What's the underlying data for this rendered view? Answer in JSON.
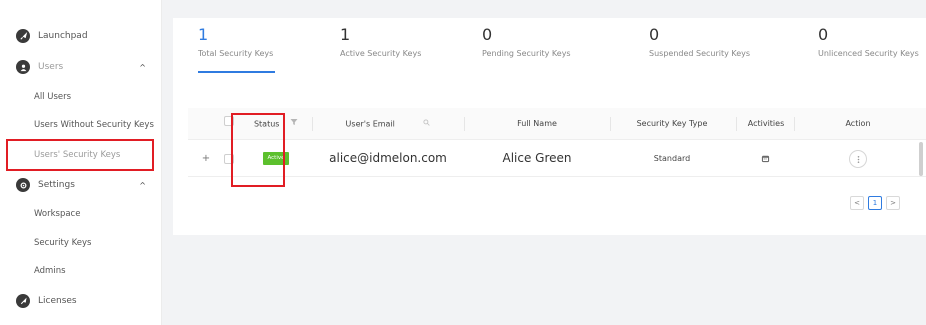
{
  "sidebar": {
    "launchpad": "Launchpad",
    "users": {
      "label": "Users",
      "chevron": "^",
      "items": [
        "All Users",
        "Users Without Security Keys",
        "Users' Security Keys"
      ]
    },
    "settings": {
      "label": "Settings",
      "chevron": "^",
      "items": [
        "Workspace",
        "Security Keys",
        "Admins"
      ]
    },
    "licenses": "Licenses"
  },
  "stats": [
    {
      "value": "1",
      "label": "Total Security Keys"
    },
    {
      "value": "1",
      "label": "Active Security Keys"
    },
    {
      "value": "0",
      "label": "Pending Security Keys"
    },
    {
      "value": "0",
      "label": "Suspended Security Keys"
    },
    {
      "value": "0",
      "label": "Unlicenced Security Keys"
    }
  ],
  "table": {
    "headers": {
      "status": "Status",
      "email": "User's Email",
      "fullname": "Full Name",
      "keytype": "Security Key Type",
      "activities": "Activities",
      "action": "Action"
    },
    "rows": [
      {
        "expand": "+",
        "status": "Active",
        "email": "alice@idmelon.com",
        "fullname": "Alice Green",
        "keytype": "Standard"
      }
    ]
  },
  "pagination": {
    "prev": "<",
    "current": "1",
    "next": ">"
  },
  "colors": {
    "accent": "#2f7be0",
    "highlight": "#e11d24",
    "active_badge": "#5cc02d"
  },
  "icons": [
    "rocket-icon",
    "user-icon",
    "gear-icon",
    "license-icon",
    "filter-icon",
    "search-icon",
    "calendar-icon",
    "more-vertical-icon"
  ]
}
